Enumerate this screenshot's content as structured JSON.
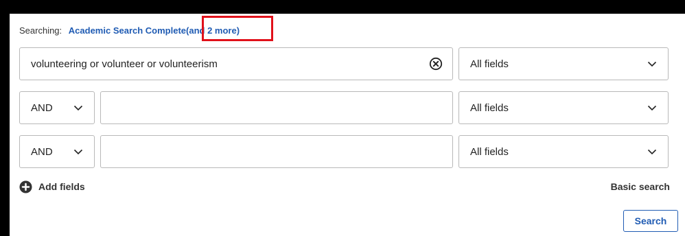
{
  "searching": {
    "prefix": "Searching:",
    "database": "Academic Search Complete",
    "more": "(and 2 more)"
  },
  "rows": [
    {
      "term_value": "volunteering or volunteer or volunteerism",
      "field": "All fields"
    },
    {
      "operator": "AND",
      "term_value": "",
      "field": "All fields"
    },
    {
      "operator": "AND",
      "term_value": "",
      "field": "All fields"
    }
  ],
  "actions": {
    "add_fields": "Add fields",
    "basic_search": "Basic search",
    "search": "Search"
  },
  "icons": {
    "clear": "clear-circle-x-icon",
    "chevron": "chevron-down-icon",
    "add": "plus-circle-icon"
  },
  "colors": {
    "link": "#1f5bb3",
    "highlight": "#e0101a",
    "border": "#b8b8b8"
  }
}
